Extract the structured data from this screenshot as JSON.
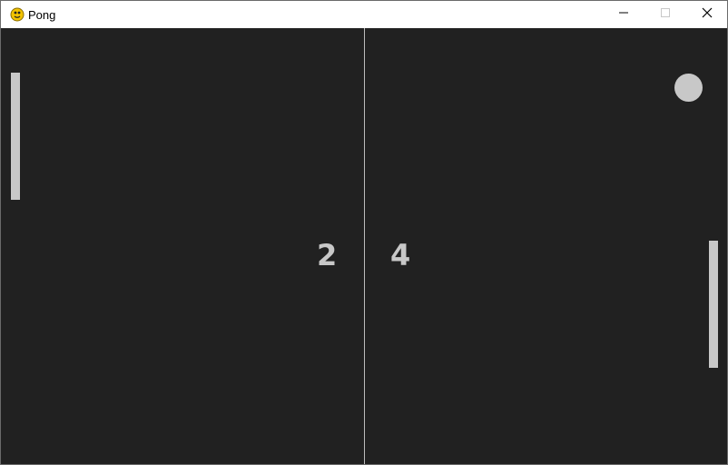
{
  "window": {
    "title": "Pong",
    "icon": "python-snake-icon"
  },
  "controls": {
    "minimize": "minimize-icon",
    "maximize": "maximize-icon",
    "close": "close-icon"
  },
  "game": {
    "background_color": "#212121",
    "element_color": "#c8c8c8",
    "left_score": "2",
    "right_score": "4"
  }
}
